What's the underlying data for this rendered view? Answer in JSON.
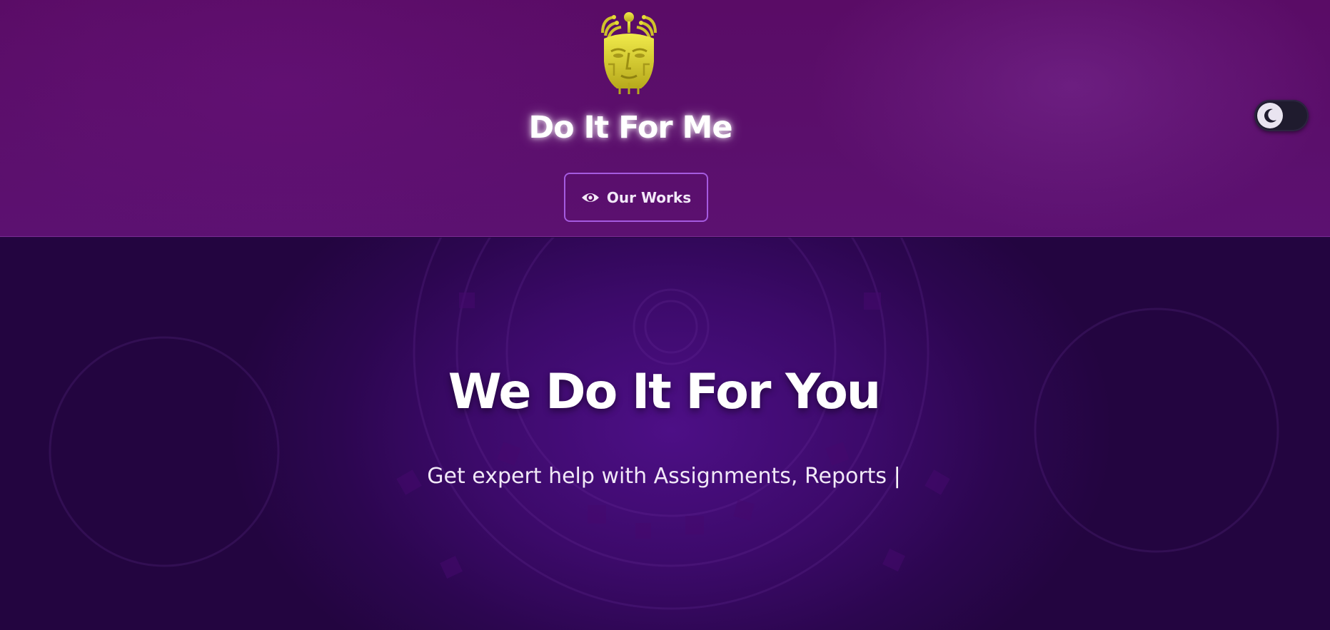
{
  "header": {
    "brand_title": "Do It For Me",
    "logo_icon": "golden-circuit-mask-logo",
    "works_button": {
      "label": "Our Works",
      "icon": "eye-icon"
    },
    "theme_toggle": {
      "icon": "moon-icon",
      "state": "dark"
    }
  },
  "hero": {
    "title": "We Do It For You",
    "subtitle": "Get expert help with Assignments, Reports",
    "cursor": "|"
  },
  "colors": {
    "header_bg": "#5a0c66",
    "hero_bg": "#3c0a6a",
    "button_border": "#a55be0",
    "logo_gold": "#d8d02a",
    "toggle_bg": "#1f1b2e"
  }
}
